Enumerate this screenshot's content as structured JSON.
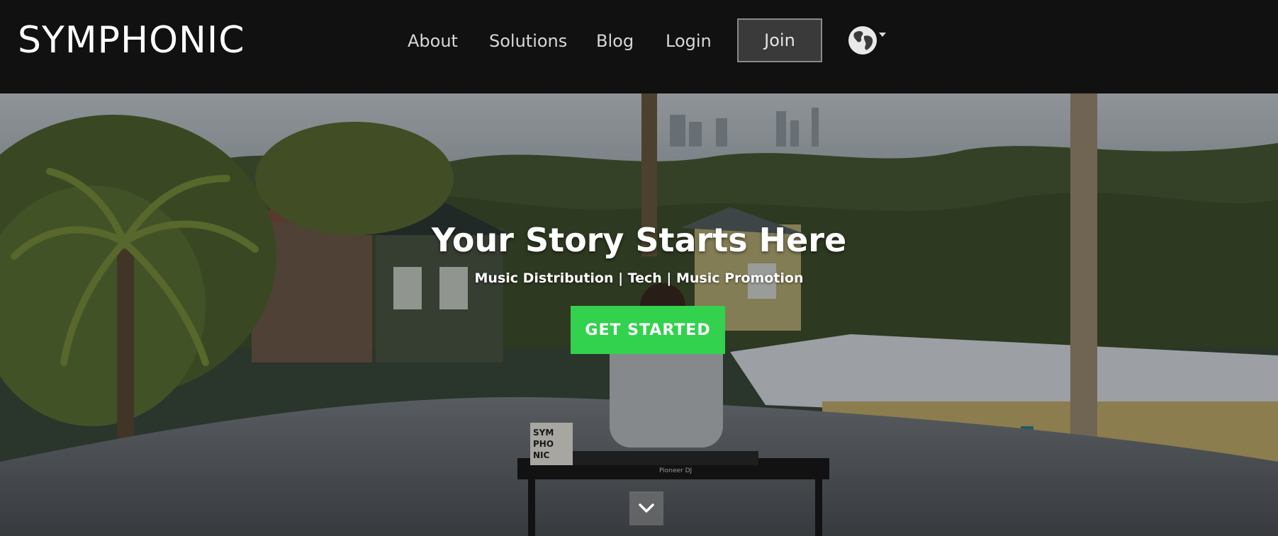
{
  "header": {
    "logo_text": "SYMPHONIC",
    "nav": [
      {
        "label": "About"
      },
      {
        "label": "Solutions"
      },
      {
        "label": "Blog"
      },
      {
        "label": "Login"
      }
    ],
    "join_label": "Join",
    "language_icon": "globe-icon"
  },
  "hero": {
    "headline": "Your Story Starts Here",
    "subline": "Music Distribution | Tech | Music Promotion",
    "cta_label": "GET STARTED",
    "scroll_icon": "chevron-down-icon",
    "mixer_brand": "Pioneer DJ",
    "cube_text": [
      "SYM",
      "PHO",
      "NIC"
    ]
  },
  "colors": {
    "topbar": "#111111",
    "cta": "#32d14e",
    "nav_text": "#d8d8d8"
  }
}
